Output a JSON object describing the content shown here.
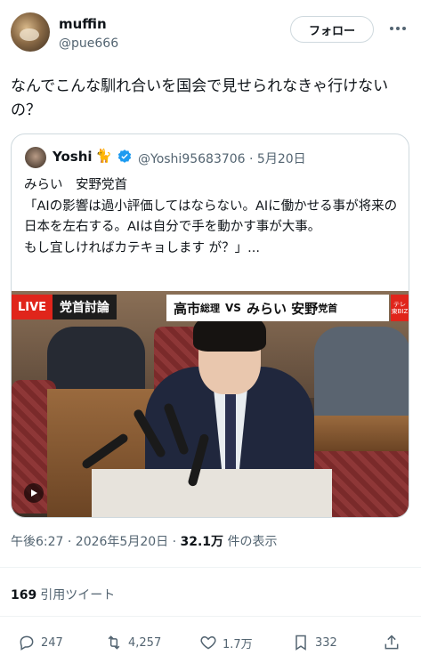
{
  "author": {
    "display_name": "muffin",
    "handle": "@pue666",
    "follow_label": "フォロー"
  },
  "tweet": {
    "text": "なんでこんな馴れ合いを国会で見せられなきゃ行けないの？"
  },
  "quote": {
    "display_name": "Yoshi",
    "emoji": "🐈",
    "handle_date": "@Yoshi95683706 · 5月20日",
    "text_lines": [
      "みらい　安野党首",
      "「AIの影響は過小評価してはならない。AIに働かせる事が将来の日本を左右する。AIは自分で手を動かす事が大事。",
      "もし宜しければカテキョします が？」..."
    ],
    "media": {
      "live_label": "LIVE",
      "caption_left": "党首討論",
      "caption_right_1": "高市",
      "caption_right_1_small": "総理",
      "caption_vs": "VS",
      "caption_right_2": "みらい 安野",
      "caption_right_2_small": "党首",
      "channel_logo": "テレ東BIZ"
    }
  },
  "meta": {
    "time_date": "午後6:27 · 2026年5月20日 · ",
    "views_count": "32.1万",
    "views_label": " 件の表示"
  },
  "quote_tweets": {
    "count": "169",
    "label": "引用ツイート"
  },
  "actions": {
    "replies": "247",
    "retweets": "4,257",
    "likes": "1.7万",
    "bookmarks": "332"
  },
  "colors": {
    "text": "#0f1419",
    "secondary": "#536471",
    "verified": "#1d9bf0",
    "live_red": "#e0251b"
  }
}
